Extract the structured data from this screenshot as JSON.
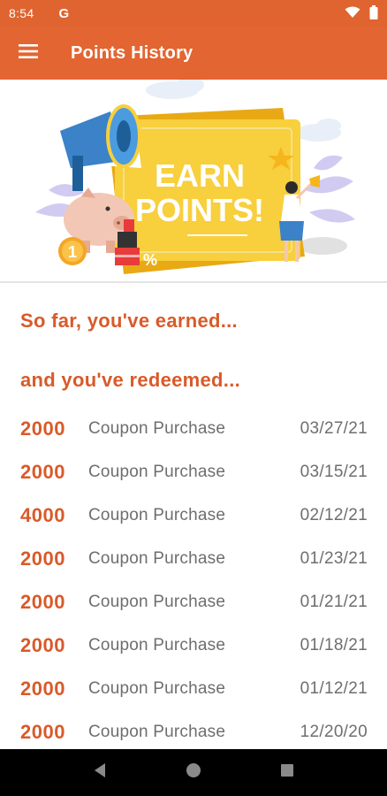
{
  "status_bar": {
    "time": "8:54",
    "google_icon_letter": "G",
    "icons": [
      "wifi-icon",
      "battery-icon"
    ]
  },
  "app_bar": {
    "title": "Points History",
    "menu_icon": "hamburger-menu-icon"
  },
  "banner": {
    "line1": "EARN",
    "line2": "POINTS!",
    "coin_label": "1",
    "percent_label": "%"
  },
  "content": {
    "earned_heading": "So far, you've earned...",
    "redeemed_heading": "and you've redeemed...",
    "history": [
      {
        "points": "2000",
        "description": "Coupon Purchase",
        "date": "03/27/21"
      },
      {
        "points": "2000",
        "description": "Coupon Purchase",
        "date": "03/15/21"
      },
      {
        "points": "4000",
        "description": "Coupon Purchase",
        "date": "02/12/21"
      },
      {
        "points": "2000",
        "description": "Coupon Purchase",
        "date": "01/23/21"
      },
      {
        "points": "2000",
        "description": "Coupon Purchase",
        "date": "01/21/21"
      },
      {
        "points": "2000",
        "description": "Coupon Purchase",
        "date": "01/18/21"
      },
      {
        "points": "2000",
        "description": "Coupon Purchase",
        "date": "01/12/21"
      },
      {
        "points": "2000",
        "description": "Coupon Purchase",
        "date": "12/20/20"
      }
    ]
  },
  "nav_bar": {
    "icons": [
      "back-icon",
      "home-icon",
      "recents-icon"
    ]
  },
  "colors": {
    "primary": "#e36531",
    "accent_text": "#d95a2a",
    "banner_yellow": "#f8cf3c",
    "body_text": "#6e6e6e"
  }
}
